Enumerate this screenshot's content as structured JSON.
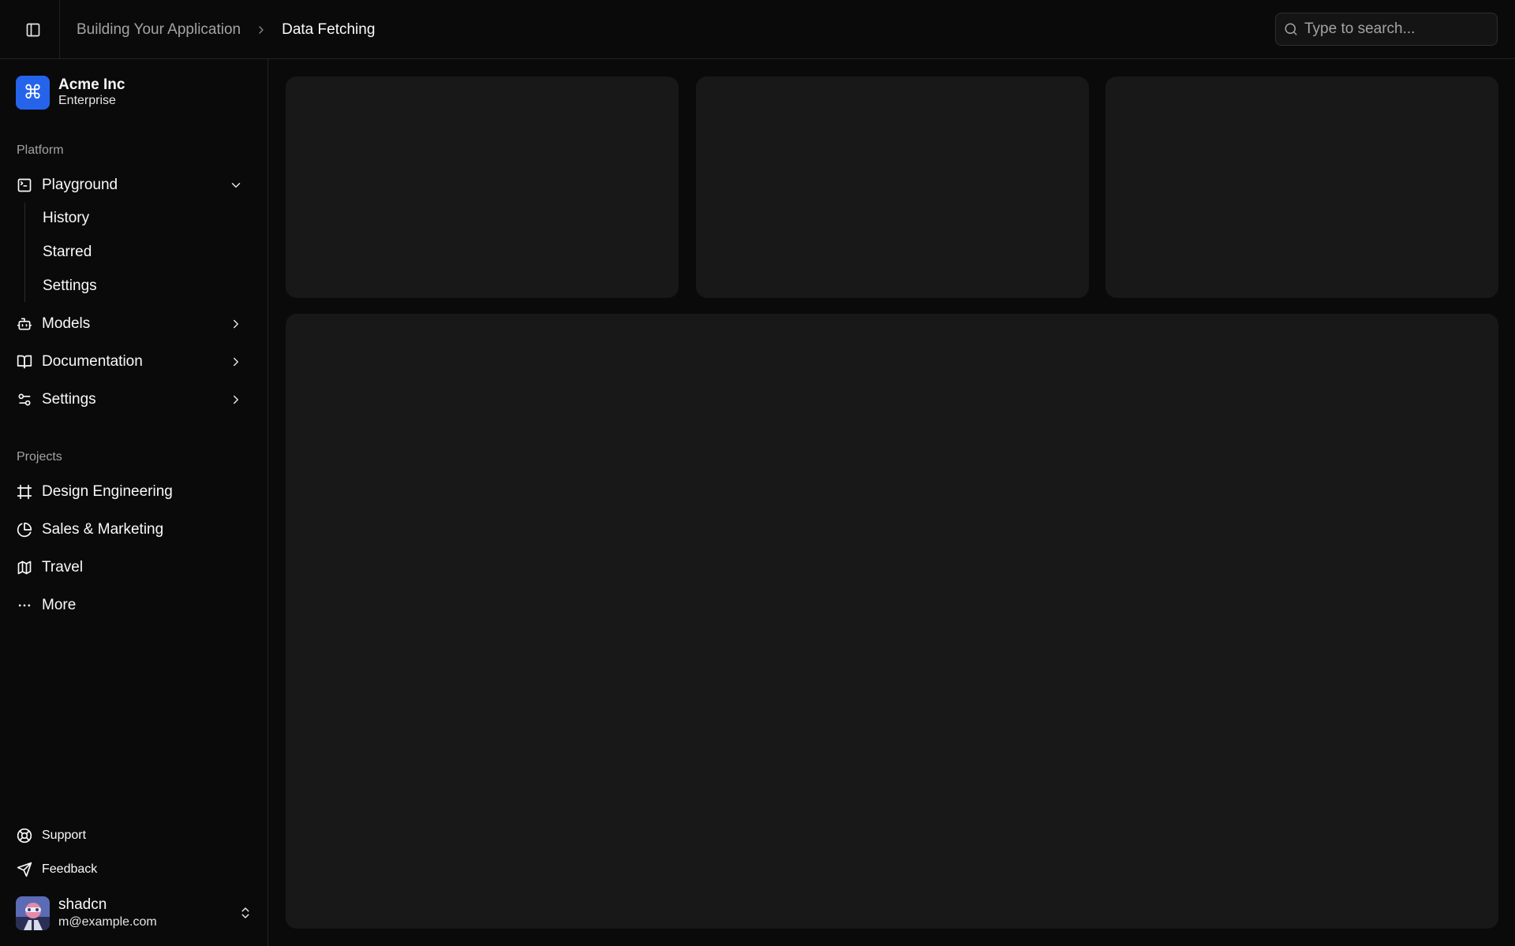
{
  "topbar": {
    "breadcrumb": {
      "parent": "Building Your Application",
      "current": "Data Fetching"
    },
    "search": {
      "placeholder": "Type to search..."
    }
  },
  "sidebar": {
    "team": {
      "logo_glyph": "⌘",
      "name": "Acme Inc",
      "plan": "Enterprise",
      "logo_color": "#2563eb"
    },
    "platform": {
      "label": "Platform",
      "items": [
        {
          "label": "Playground",
          "icon": "terminal-square-icon",
          "expanded": true,
          "children": [
            "History",
            "Starred",
            "Settings"
          ]
        },
        {
          "label": "Models",
          "icon": "bot-icon",
          "expanded": false
        },
        {
          "label": "Documentation",
          "icon": "book-open-icon",
          "expanded": false
        },
        {
          "label": "Settings",
          "icon": "settings-2-icon",
          "expanded": false
        }
      ]
    },
    "projects": {
      "label": "Projects",
      "items": [
        {
          "label": "Design Engineering",
          "icon": "frame-icon"
        },
        {
          "label": "Sales & Marketing",
          "icon": "pie-chart-icon"
        },
        {
          "label": "Travel",
          "icon": "map-icon"
        },
        {
          "label": "More",
          "icon": "more-horizontal-icon"
        }
      ]
    },
    "footer": [
      {
        "label": "Support",
        "icon": "life-buoy-icon"
      },
      {
        "label": "Feedback",
        "icon": "send-icon"
      }
    ],
    "user": {
      "name": "shadcn",
      "email": "m@example.com"
    }
  },
  "theme": {
    "background": "#0a0a0a",
    "card": "#181818",
    "accent": "#2563eb"
  }
}
